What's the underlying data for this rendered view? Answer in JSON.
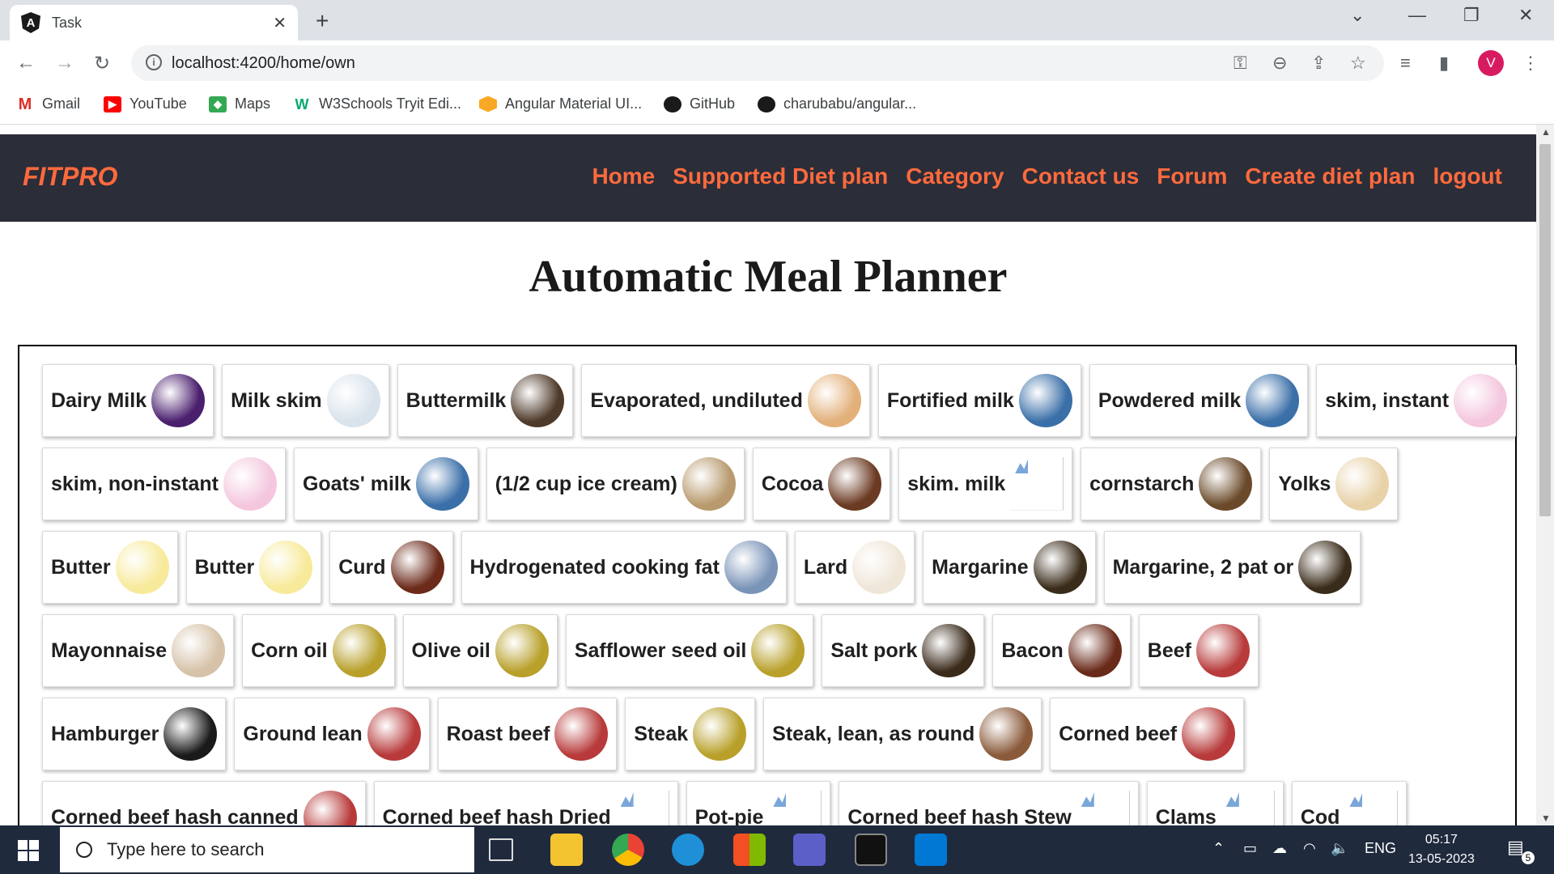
{
  "browser": {
    "tab_title": "Task",
    "tab_close": "✕",
    "new_tab": "+",
    "url": "localhost:4200/home/own",
    "avatar_letter": "V",
    "bookmarks": [
      "Gmail",
      "YouTube",
      "Maps",
      "W3Schools Tryit Edi...",
      "Angular Material UI...",
      "GitHub",
      "charubabu/angular..."
    ]
  },
  "app": {
    "brand": "FITPRO",
    "menu": [
      "Home",
      "Supported Diet plan",
      "Category",
      "Contact us",
      "Forum",
      "Create diet plan",
      "logout"
    ],
    "title": "Automatic Meal Planner"
  },
  "foods": [
    [
      {
        "label": "Dairy Milk",
        "color": "#4a1f6e"
      },
      {
        "label": "Milk skim",
        "color": "#d9e3ec"
      },
      {
        "label": "Buttermilk",
        "color": "#4e3a2a"
      },
      {
        "label": "Evaporated, undiluted",
        "color": "#e3b07a"
      },
      {
        "label": "Fortified milk",
        "color": "#3a6fa8"
      },
      {
        "label": "Powdered milk",
        "color": "#3a6fa8"
      },
      {
        "label": "skim, instant",
        "color": "#f4c7de"
      }
    ],
    [
      {
        "label": "skim, non-instant",
        "color": "#f4c7de"
      },
      {
        "label": "Goats' milk",
        "color": "#3a6fa8"
      },
      {
        "label": "(1/2 cup ice cream)",
        "color": "#b89a6e"
      },
      {
        "label": "Cocoa",
        "color": "#6b3a22"
      },
      {
        "label": "skim. milk",
        "broken": true
      },
      {
        "label": "cornstarch",
        "color": "#6a4a2a"
      },
      {
        "label": "Yolks",
        "color": "#e8d2a8"
      }
    ],
    [
      {
        "label": "Butter",
        "color": "#f7ea9a"
      },
      {
        "label": "Butter",
        "color": "#f7ea9a"
      },
      {
        "label": "Curd",
        "color": "#6b2a1a"
      },
      {
        "label": "Hydrogenated cooking fat",
        "color": "#7a94b8"
      },
      {
        "label": "Lard",
        "color": "#efe6d8"
      },
      {
        "label": "Margarine",
        "color": "#3a2c1a"
      },
      {
        "label": "Margarine, 2 pat or",
        "color": "#3a2c1a"
      }
    ],
    [
      {
        "label": "Mayonnaise",
        "color": "#d6c2a8"
      },
      {
        "label": "Corn oil",
        "color": "#b8a02a"
      },
      {
        "label": "Olive oil",
        "color": "#b8a02a"
      },
      {
        "label": "Safflower seed oil",
        "color": "#b8a02a"
      },
      {
        "label": "Salt pork",
        "color": "#3a2a1a"
      },
      {
        "label": "Bacon",
        "color": "#6a2a1a"
      },
      {
        "label": "Beef",
        "color": "#b83a3a"
      }
    ],
    [
      {
        "label": "Hamburger",
        "color": "#1a1a1a"
      },
      {
        "label": "Ground lean",
        "color": "#b83a3a"
      },
      {
        "label": "Roast beef",
        "color": "#b83a3a"
      },
      {
        "label": "Steak",
        "color": "#b8a02a"
      },
      {
        "label": "Steak, lean, as round",
        "color": "#8a5a3a"
      },
      {
        "label": "Corned beef",
        "color": "#b83a3a"
      }
    ],
    [
      {
        "label": "Corned beef hash canned",
        "color": "#b83a3a"
      },
      {
        "label": "Corned beef hash Dried",
        "broken": true
      },
      {
        "label": "Pot-pie",
        "broken": true
      },
      {
        "label": "Corned beef hash Stew",
        "broken": true
      },
      {
        "label": "Clams",
        "broken": true
      },
      {
        "label": "Cod",
        "broken": true
      }
    ]
  ],
  "taskbar": {
    "search_placeholder": "Type here to search",
    "lang": "ENG",
    "time": "05:17",
    "date": "13-05-2023",
    "notifications": "5"
  }
}
